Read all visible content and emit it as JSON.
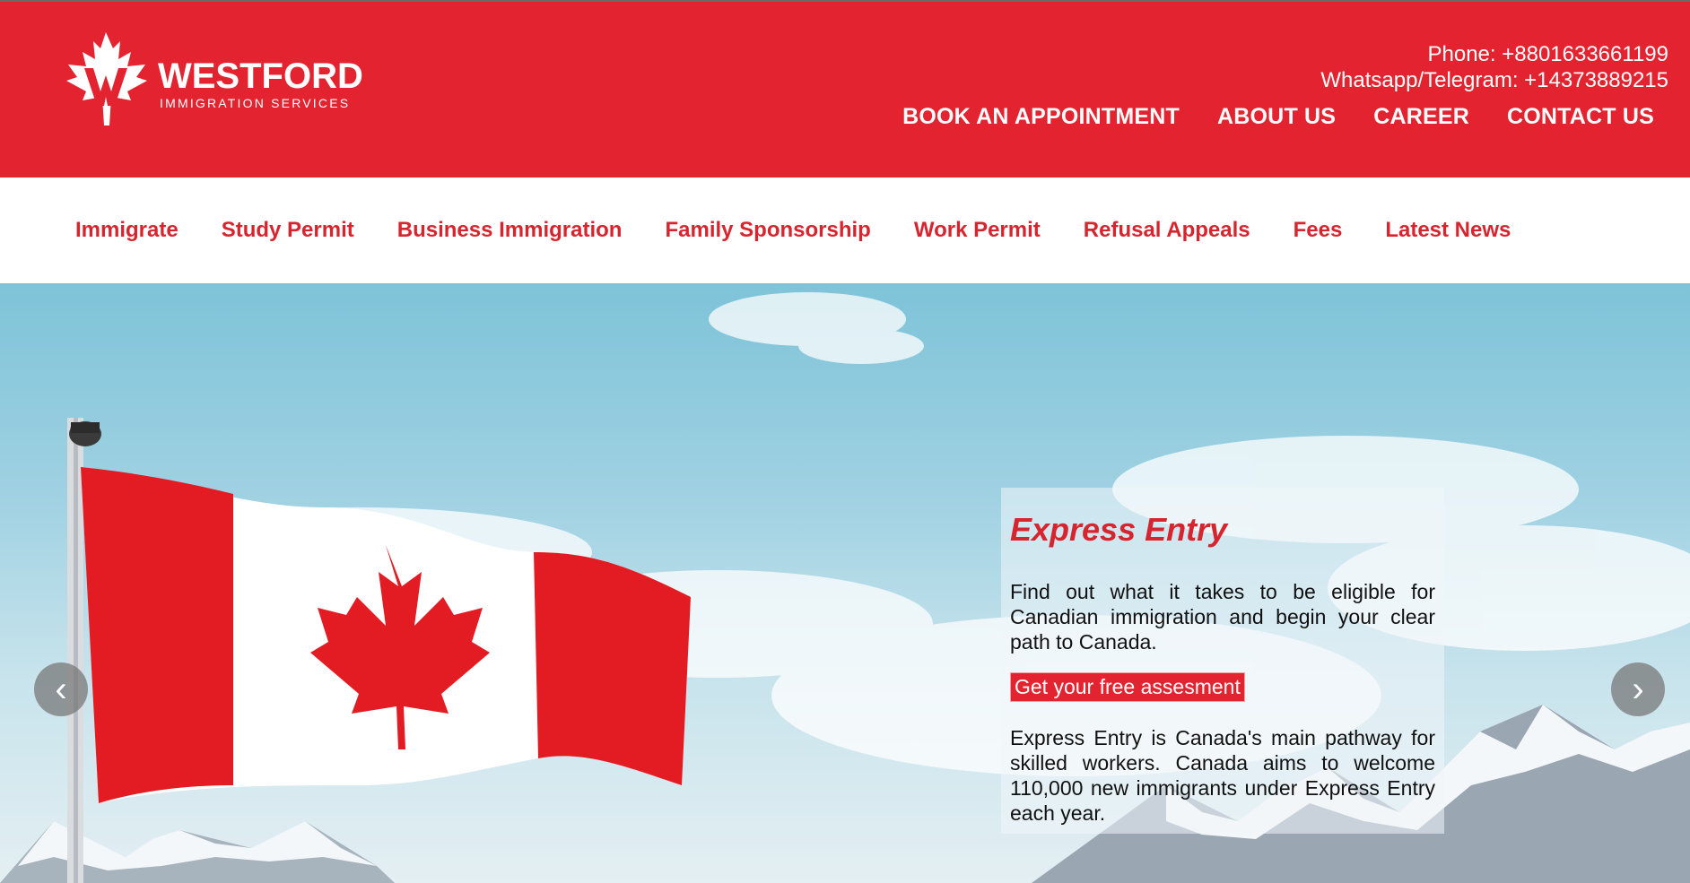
{
  "brand": {
    "name": "WESTFORD",
    "tagline": "IMMIGRATION SERVICES",
    "logo_icon": "maple-w-icon"
  },
  "contact": {
    "phone": "Phone: +8801633661199",
    "whatsapp": "Whatsapp/Telegram: +14373889215"
  },
  "top_nav": [
    "BOOK AN APPOINTMENT",
    "ABOUT US",
    "CAREER",
    "CONTACT US"
  ],
  "main_nav": [
    "Immigrate",
    "Study Permit",
    "Business Immigration",
    "Family Sponsorship",
    "Work Permit",
    "Refusal Appeals",
    "Fees",
    "Latest News"
  ],
  "hero": {
    "title": "Express Entry",
    "intro": "Find out what it takes to be eligible for Canadian immigration and begin your clear path to Canada.",
    "cta": "Get your free assesment",
    "body": "Express Entry is Canada's main pathway for skilled workers. Canada aims to welcome 110,000 new immigrants under Express Entry each year.",
    "prev_icon": "‹",
    "next_icon": "›"
  },
  "colors": {
    "brand_red": "#e3232f",
    "nav_red": "#d7252f",
    "white": "#ffffff"
  }
}
